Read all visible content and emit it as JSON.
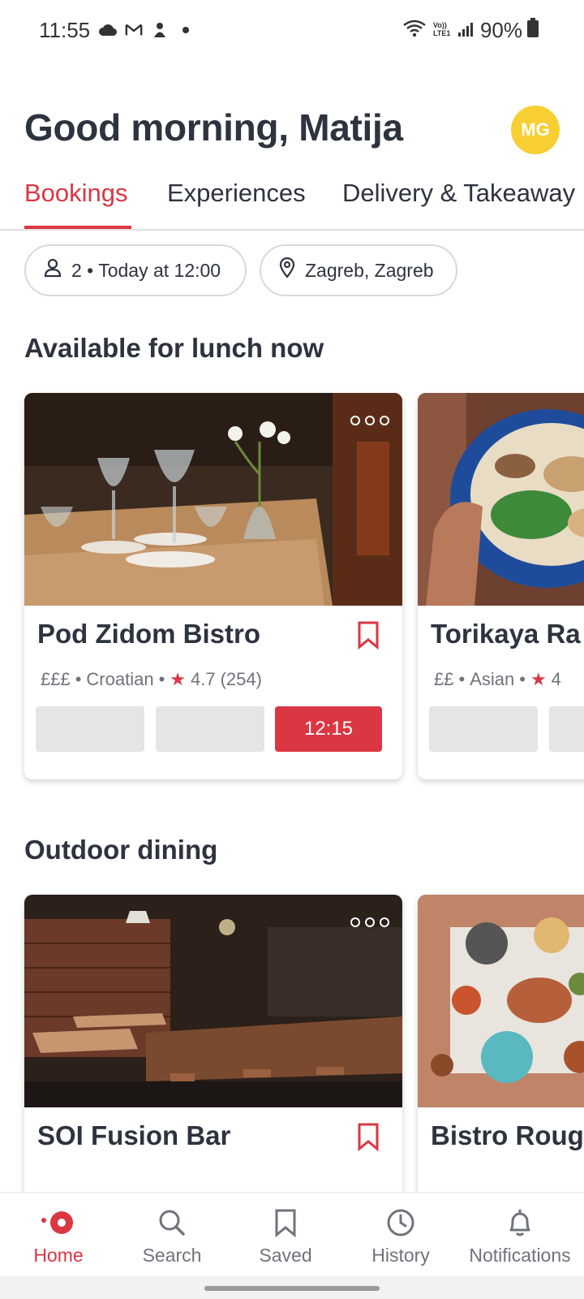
{
  "status_bar": {
    "time": "11:55",
    "battery": "90%",
    "left_icons": [
      "cloud-icon",
      "gmail-icon",
      "notification-icon",
      "dot-icon"
    ],
    "right_icons": [
      "wifi-icon",
      "volte-icon",
      "signal-icon",
      "battery-icon"
    ]
  },
  "header": {
    "greeting": "Good morning, Matija",
    "avatar_initials": "MG",
    "avatar_color": "#f7cf33"
  },
  "tabs": [
    {
      "label": "Bookings",
      "active": true
    },
    {
      "label": "Experiences",
      "active": false
    },
    {
      "label": "Delivery & Takeaway",
      "active": false
    }
  ],
  "filters": {
    "party": "2 • Today at 12:00",
    "location": "Zagreb, Zagreb"
  },
  "sections": {
    "lunch": {
      "title": "Available for lunch now",
      "cards": [
        {
          "name": "Pod Zidom Bistro",
          "price": "£££",
          "cuisine": "Croatian",
          "rating": "4.7",
          "reviews": "(254)",
          "slot_time": "12:15"
        },
        {
          "name": "Torikaya Ra",
          "price": "££",
          "cuisine": "Asian",
          "rating": "4"
        }
      ]
    },
    "outdoor": {
      "title": "Outdoor dining",
      "cards": [
        {
          "name": "SOI Fusion Bar"
        },
        {
          "name": "Bistro Roug"
        }
      ]
    }
  },
  "bottom_nav": [
    {
      "label": "Home",
      "icon": "home-icon",
      "active": true
    },
    {
      "label": "Search",
      "icon": "search-icon",
      "active": false
    },
    {
      "label": "Saved",
      "icon": "bookmark-icon",
      "active": false
    },
    {
      "label": "History",
      "icon": "history-icon",
      "active": false
    },
    {
      "label": "Notifications",
      "icon": "bell-icon",
      "active": false
    }
  ],
  "colors": {
    "accent": "#da3743",
    "text": "#2d333f",
    "muted": "#6f737b"
  }
}
